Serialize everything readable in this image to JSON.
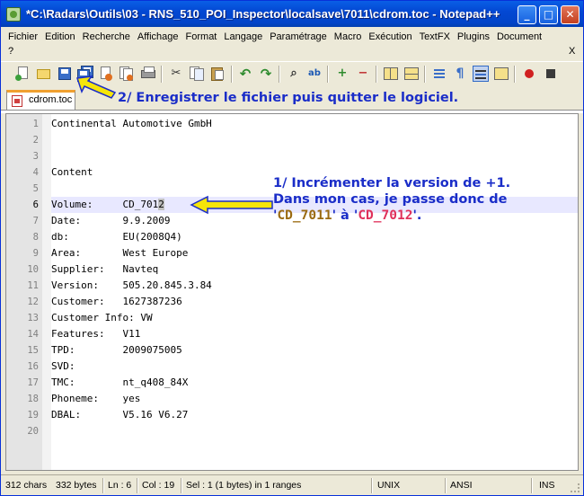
{
  "window": {
    "title": "*C:\\Radars\\Outils\\03 - RNS_510_POI_Inspector\\localsave\\7011\\cdrom.toc - Notepad++",
    "minimize_glyph": "_",
    "maximize_glyph": "□",
    "close_glyph": "✕"
  },
  "menu": {
    "items": [
      "Fichier",
      "Edition",
      "Recherche",
      "Affichage",
      "Format",
      "Langage",
      "Paramétrage",
      "Macro",
      "Exécution",
      "TextFX",
      "Plugins",
      "Document"
    ],
    "help": "?",
    "close_doc": "X"
  },
  "toolbar": {
    "icons": [
      "new-file-icon",
      "open-file-icon",
      "save-icon",
      "save-all-icon",
      "close-icon",
      "close-all-icon",
      "print-icon",
      "cut-icon",
      "copy-icon",
      "paste-icon",
      "undo-icon",
      "redo-icon",
      "find-icon",
      "replace-icon",
      "zoom-in-icon",
      "zoom-out-icon",
      "sync-vertical-icon",
      "sync-horizontal-icon",
      "word-wrap-icon",
      "show-all-chars-icon",
      "indent-guide-icon",
      "user-lang-icon",
      "record-macro-icon",
      "stop-record-icon"
    ],
    "glyphs": {
      "cut": "✂",
      "undo": "↶",
      "redo": "↷",
      "find": "⌕",
      "replace": "ab",
      "zoom_in": "+",
      "zoom_out": "−",
      "pilcrow": "¶"
    }
  },
  "tab": {
    "label": "cdrom.toc"
  },
  "editor": {
    "current_line": 6,
    "lines": [
      "Continental Automotive GmbH",
      "",
      "",
      "Content",
      "",
      "Volume:     CD_7012",
      "Date:       9.9.2009",
      "db:         EU(2008Q4)",
      "Area:       West Europe",
      "Supplier:   Navteq",
      "Version:    505.20.845.3.84",
      "Customer:   1627387236",
      "Customer Info: VW",
      "Features:   V11",
      "TPD:        2009075005",
      "SVD:",
      "TMC:        nt_q408_84X",
      "Phoneme:    yes",
      "DBAL:       V5.16 V6.27",
      ""
    ]
  },
  "annotations": {
    "save": "2/ Enregistrer le fichier puis quitter le logiciel.",
    "increment_line1": "1/ Incrémenter la version de +1.",
    "increment_line2": "Dans mon cas, je passe donc de",
    "quote_open": "'",
    "old_version": "CD_7011",
    "middle": "' à '",
    "new_version": "CD_7012",
    "quote_close": "'.",
    "color_blue": "#1A2DC8",
    "color_old": "#9A6A10",
    "color_new": "#E0305A",
    "arrow_color": "#F5E50A"
  },
  "status": {
    "chars": "312 chars",
    "bytes": "332 bytes",
    "line": "Ln : 6",
    "col": "Col : 19",
    "sel": "Sel : 1 (1 bytes) in 1 ranges",
    "eol": "UNIX",
    "encoding": "ANSI",
    "mode": "INS"
  }
}
